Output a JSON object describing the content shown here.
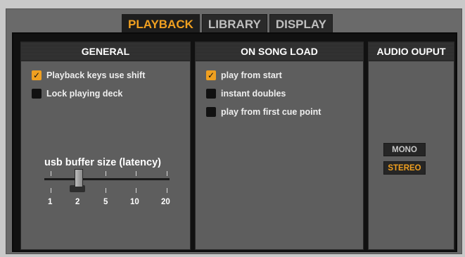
{
  "tabs": [
    {
      "label": "PLAYBACK",
      "active": true
    },
    {
      "label": "LIBRARY",
      "active": false
    },
    {
      "label": "DISPLAY",
      "active": false
    }
  ],
  "general": {
    "title": "GENERAL",
    "options": [
      {
        "label": "Playback keys use shift",
        "checked": true
      },
      {
        "label": "Lock playing deck",
        "checked": false
      }
    ],
    "slider": {
      "label": "usb buffer size (latency)",
      "ticks": [
        "1",
        "2",
        "5",
        "10",
        "20"
      ],
      "value": "2"
    }
  },
  "song_load": {
    "title": "ON SONG LOAD",
    "options": [
      {
        "label": "play from start",
        "checked": true
      },
      {
        "label": "instant doubles",
        "checked": false
      },
      {
        "label": "play from first cue point",
        "checked": false
      }
    ]
  },
  "audio_output": {
    "title": "AUDIO OUPUT",
    "mono_label": "MONO",
    "stereo_label": "STEREO",
    "selected": "STEREO"
  },
  "colors": {
    "accent": "#f0a020",
    "panel": "#5e5e5e",
    "header": "#2b2b2b"
  },
  "icons": {
    "check": "✓"
  }
}
